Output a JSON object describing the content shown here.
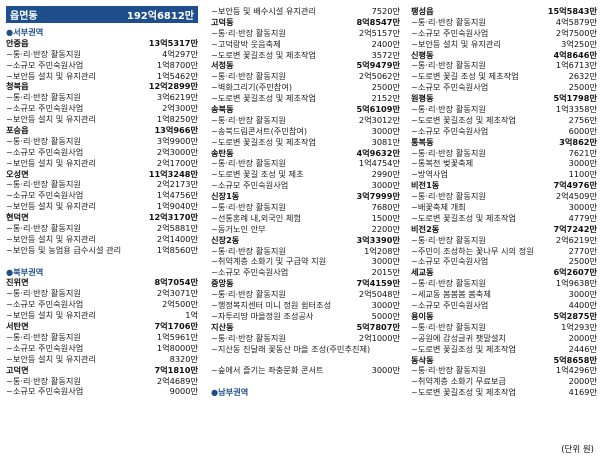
{
  "header": {
    "label": "읍면동",
    "total": "192억6812만"
  },
  "columns": [
    [
      {
        "t": "section",
        "l": "●서부권역"
      },
      {
        "t": "place",
        "l": "안중읍",
        "r": "13억5317만"
      },
      {
        "t": "item",
        "l": "~통·리·반장 활동지원",
        "r": "4억297만"
      },
      {
        "t": "item",
        "l": "~소규모 주민숙원사업",
        "r": "1억8700만"
      },
      {
        "t": "item",
        "l": "~보안등 설치 및 유지관리",
        "r": "1억5462만"
      },
      {
        "t": "place",
        "l": "청북읍",
        "r": "12억2899만"
      },
      {
        "t": "item",
        "l": "~통·리·반장 활동지원",
        "r": "3억6219만"
      },
      {
        "t": "item",
        "l": "~소규모 주민숙원사업",
        "r": "2억300만"
      },
      {
        "t": "item",
        "l": "~보안등 설치 및 유지관리",
        "r": "1억8250만"
      },
      {
        "t": "place",
        "l": "포승읍",
        "r": "13억966만"
      },
      {
        "t": "item",
        "l": "~통·리·반장 활동지원",
        "r": "3억9900만"
      },
      {
        "t": "item",
        "l": "~소규모 주민숙원사업",
        "r": "2억3000만"
      },
      {
        "t": "item",
        "l": "~보안등 설치 및 유지관리",
        "r": "2억1700만"
      },
      {
        "t": "place",
        "l": "오성면",
        "r": "11억3248만"
      },
      {
        "t": "item",
        "l": "~통·리·반장 활동지원",
        "r": "2억2173만"
      },
      {
        "t": "item",
        "l": "~소규모 주민숙원사업",
        "r": "1억4756만"
      },
      {
        "t": "item",
        "l": "~보안등 설치 및 유지관리",
        "r": "1억9040만"
      },
      {
        "t": "place",
        "l": "현덕면",
        "r": "12억3170만"
      },
      {
        "t": "item",
        "l": "~통·리·반장 활동지원",
        "r": "2억5881만"
      },
      {
        "t": "item",
        "l": "~보안등 설치 및 유지관리",
        "r": "2억1400만"
      },
      {
        "t": "item",
        "l": "~보안등 및 농업용 급수시설 관리",
        "r": "1억8560만"
      },
      {
        "t": "gap"
      },
      {
        "t": "section",
        "l": "●북부권역"
      },
      {
        "t": "place",
        "l": "진위면",
        "r": "8억7054만"
      },
      {
        "t": "item",
        "l": "~통·리·반장 활동지원",
        "r": "2억3071만"
      },
      {
        "t": "item",
        "l": "~소규모 주민숙원사업",
        "r": "2억500만"
      },
      {
        "t": "item",
        "l": "~보안등 설치 및 유지관리",
        "r": "1억"
      },
      {
        "t": "place",
        "l": "서탄면",
        "r": "7억1706만"
      },
      {
        "t": "item",
        "l": "~통·리·반장 활동지원",
        "r": "1억5961만"
      },
      {
        "t": "item",
        "l": "~소규모 주민숙원사업",
        "r": "1억8000만"
      },
      {
        "t": "item",
        "l": "~보안등 설치 및 유지관리",
        "r": "8320만"
      },
      {
        "t": "place",
        "l": "고덕면",
        "r": "7억1810만"
      },
      {
        "t": "item",
        "l": "~통·리·반장 활동지원",
        "r": "2억4689만"
      },
      {
        "t": "item",
        "l": "~소규모 주민숙원사업",
        "r": "9000만"
      }
    ],
    [
      {
        "t": "item",
        "l": "~보안등 및 배수시설 유지관리",
        "r": "7520만"
      },
      {
        "t": "place",
        "l": "고덕동",
        "r": "8억8547만"
      },
      {
        "t": "item",
        "l": "~통·리·반장 활동지원",
        "r": "2억5157만"
      },
      {
        "t": "item",
        "l": "~고덕랑박 웃음축제",
        "r": "2400만"
      },
      {
        "t": "item",
        "l": "~도로변 꽃길조성 및 제초작업",
        "r": "3572만"
      },
      {
        "t": "place",
        "l": "서정동",
        "r": "5억9479만"
      },
      {
        "t": "item",
        "l": "~통·리·반장 활동지원",
        "r": "2억5062만"
      },
      {
        "t": "item",
        "l": "~벽화그리기(주민참여)",
        "r": "2500만"
      },
      {
        "t": "item",
        "l": "~도로변 꽃길조성 및 제초작업",
        "r": "2152만"
      },
      {
        "t": "place",
        "l": "송북동",
        "r": "5억6109만"
      },
      {
        "t": "item",
        "l": "~통·리·반장 활동지원",
        "r": "2억3012만"
      },
      {
        "t": "item",
        "l": "~송북드림콘서트(주민참여)",
        "r": "3000만"
      },
      {
        "t": "item",
        "l": "~도로변 꽃길조성 및 제초작업",
        "r": "3081만"
      },
      {
        "t": "place",
        "l": "송탄동",
        "r": "4억9632만"
      },
      {
        "t": "item",
        "l": "~통·리·반장 활동지원",
        "r": "1억4754만"
      },
      {
        "t": "item",
        "l": "~도로변 꽃길 조성 및 제초",
        "r": "2990만"
      },
      {
        "t": "item",
        "l": "~소규모 주민숙원사업",
        "r": "3000만"
      },
      {
        "t": "place",
        "l": "신장1동",
        "r": "3억7999만"
      },
      {
        "t": "item",
        "l": "~통·리·반장 활동지원",
        "r": "7680만"
      },
      {
        "t": "item",
        "l": "~선통혼례 내,외국인 체험",
        "r": "1500만"
      },
      {
        "t": "item",
        "l": "~동거노인 안부",
        "r": "2200만"
      },
      {
        "t": "place",
        "l": "신장2동",
        "r": "3억3390만"
      },
      {
        "t": "item",
        "l": "~통·리·반장 활동지원",
        "r": "1억208만"
      },
      {
        "t": "item",
        "l": "~취약계층 소화기 및 구급약 지원",
        "r": "3000만"
      },
      {
        "t": "item",
        "l": "~소규모 주민숙원사업",
        "r": "2015만"
      },
      {
        "t": "place",
        "l": "중앙동",
        "r": "7억4159만"
      },
      {
        "t": "item",
        "l": "~통·리·반장 활동지원",
        "r": "2억5048만"
      },
      {
        "t": "item",
        "l": "~행정복지센터 미니 정원 쉼터조성",
        "r": "3000만"
      },
      {
        "t": "item",
        "l": "~자투리땅 마을정원 조성공사",
        "r": "5000만"
      },
      {
        "t": "place",
        "l": "지산동",
        "r": "5억7807만"
      },
      {
        "t": "item",
        "l": "~통·리·반장 활동지원",
        "r": "2억1000만"
      },
      {
        "t": "item",
        "l": "~지산동 진달래 꽃동산 마을 조성(주민추진제)",
        "r": ""
      },
      {
        "t": "gap"
      },
      {
        "t": "item",
        "l": "~숲에서 즐기는 좌충문화 콘서트",
        "r": "3000만"
      },
      {
        "t": "gap"
      },
      {
        "t": "section",
        "l": "●남부권역"
      }
    ],
    [
      {
        "t": "place",
        "l": "팽성읍",
        "r": "15억5843만"
      },
      {
        "t": "item",
        "l": "~통·리·반장 활동지원",
        "r": "4억5879만"
      },
      {
        "t": "item",
        "l": "~소규모 주민숙원사업",
        "r": "2억7500만"
      },
      {
        "t": "item",
        "l": "~보안등 설치 및 유지관리",
        "r": "3억250만"
      },
      {
        "t": "place",
        "l": "신평동",
        "r": "4억8646만"
      },
      {
        "t": "item",
        "l": "~통·리·반장 활동지원",
        "r": "1억6713만"
      },
      {
        "t": "item",
        "l": "~도로변 꽃길 조성 및 제초작업",
        "r": "2632만"
      },
      {
        "t": "item",
        "l": "~소규모 주민숙원사업",
        "r": "2500만"
      },
      {
        "t": "place",
        "l": "원평동",
        "r": "5억1798만"
      },
      {
        "t": "item",
        "l": "~통·리·반장 활동지원",
        "r": "1억3358만"
      },
      {
        "t": "item",
        "l": "~도로변 꽃길조성 및 제초작업",
        "r": "2756만"
      },
      {
        "t": "item",
        "l": "~소규모 주민숙원사업",
        "r": "6000만"
      },
      {
        "t": "place",
        "l": "통복동",
        "r": "3억862만"
      },
      {
        "t": "item",
        "l": "~통·리·반장 활동지원",
        "r": "7621만"
      },
      {
        "t": "item",
        "l": "~통복천 벚꽃축제",
        "r": "3000만"
      },
      {
        "t": "item",
        "l": "~방역사업",
        "r": "1100만"
      },
      {
        "t": "place",
        "l": "비전1동",
        "r": "7억4976만"
      },
      {
        "t": "item",
        "l": "~통·리·반장 활동지원",
        "r": "2억4509만"
      },
      {
        "t": "item",
        "l": "~배꽃축제 개최",
        "r": "3000만"
      },
      {
        "t": "item",
        "l": "~도로변 꽃길조성 및 제초작업",
        "r": "4779만"
      },
      {
        "t": "place",
        "l": "비전2동",
        "r": "7억7242만"
      },
      {
        "t": "item",
        "l": "~통·리·반장 활동지원",
        "r": "2억6219만"
      },
      {
        "t": "item",
        "l": "~주민이 조성하는 꽃나무 시의 정원",
        "r": "2770만"
      },
      {
        "t": "item",
        "l": "~소규모 주민숙원사업",
        "r": "2500만"
      },
      {
        "t": "place",
        "l": "세교동",
        "r": "6억2607만"
      },
      {
        "t": "item",
        "l": "~통·리·반장 활동지원",
        "r": "1억9638만"
      },
      {
        "t": "item",
        "l": "~세교동 봄봄봄 봄축제",
        "r": "3000만"
      },
      {
        "t": "item",
        "l": "~소규모 주민숙원사업",
        "r": "4400만"
      },
      {
        "t": "place",
        "l": "용이동",
        "r": "5억2875만"
      },
      {
        "t": "item",
        "l": "~통·리·반장 활동지원",
        "r": "1억293만"
      },
      {
        "t": "item",
        "l": "~공원에 감성글귀 팻말설치",
        "r": "2000만"
      },
      {
        "t": "item",
        "l": "~도로변 꽃길조성 및 제초작업",
        "r": "2446만"
      },
      {
        "t": "place",
        "l": "동삭동",
        "r": "5억8658만"
      },
      {
        "t": "item",
        "l": "~통·리·반장 활동지원",
        "r": "1억4296만"
      },
      {
        "t": "item",
        "l": "~취약계층 소화기 무료보급",
        "r": "2000만"
      },
      {
        "t": "item",
        "l": "~도로변 꽃길조성 및 제초작업",
        "r": "4169만"
      }
    ]
  ],
  "footer": "(단위 원)"
}
